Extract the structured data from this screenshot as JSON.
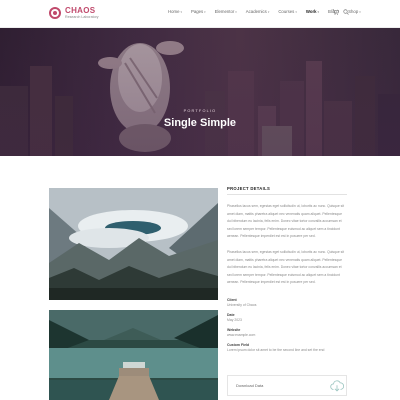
{
  "header": {
    "brand": "CHAOS",
    "tagline": "Research Laboratory",
    "nav": [
      {
        "label": "Home",
        "caret": true
      },
      {
        "label": "Pages",
        "caret": true
      },
      {
        "label": "Elementor",
        "caret": true
      },
      {
        "label": "Academics",
        "caret": true
      },
      {
        "label": "Courses",
        "caret": true
      },
      {
        "label": "Work",
        "caret": true,
        "active": true
      },
      {
        "label": "Blog",
        "caret": true
      },
      {
        "label": "Shop",
        "caret": true
      }
    ],
    "cart_count": "0"
  },
  "hero": {
    "subtitle": "PORTFOLIO",
    "title": "Single Simple"
  },
  "details": {
    "title": "PROJECT DETAILS",
    "paragraph1": "Phasellus lacus sem, egestas eget sollicitudin ut, lobortis ac nunc. Quisque sit amet diam, mattis pharetra aliquet nec venenatis quam aliquet. Pellentesque dui bibendum eu lacinia, felis enim. Donec vitae tortor convallis accumsan et sed lorem semper tempor. Pellentesque euismod ac aliquet sem a tincidunt aenean. Pellentesque imperdiet est est in posuere per sed.",
    "paragraph2": "Phasellus lacus sem, egestas eget sollicitudin ut, lobortis ac nunc. Quisque sit amet diam, mattis pharetra aliquet nec venenatis quam aliquet. Pellentesque dui bibendum eu lacinia, felis enim. Donec vitae tortor convallis accumsan et sed lorem semper tempor. Pellentesque euismod ac aliquet sem a tincidunt aenean. Pellentesque imperdiet est est in posuere per sed.",
    "meta": [
      {
        "label": "Client",
        "value": "University of Chaos"
      },
      {
        "label": "Date",
        "value": "May 2023"
      },
      {
        "label": "Website",
        "value": "www.example.com"
      },
      {
        "label": "Custom Field",
        "value": "Lorem ipsum dolor sit amet to be the second line and set the end"
      }
    ],
    "download_label": "Download Data"
  },
  "colors": {
    "accent": "#c04a6c",
    "hero_base": "#3f2b42"
  }
}
